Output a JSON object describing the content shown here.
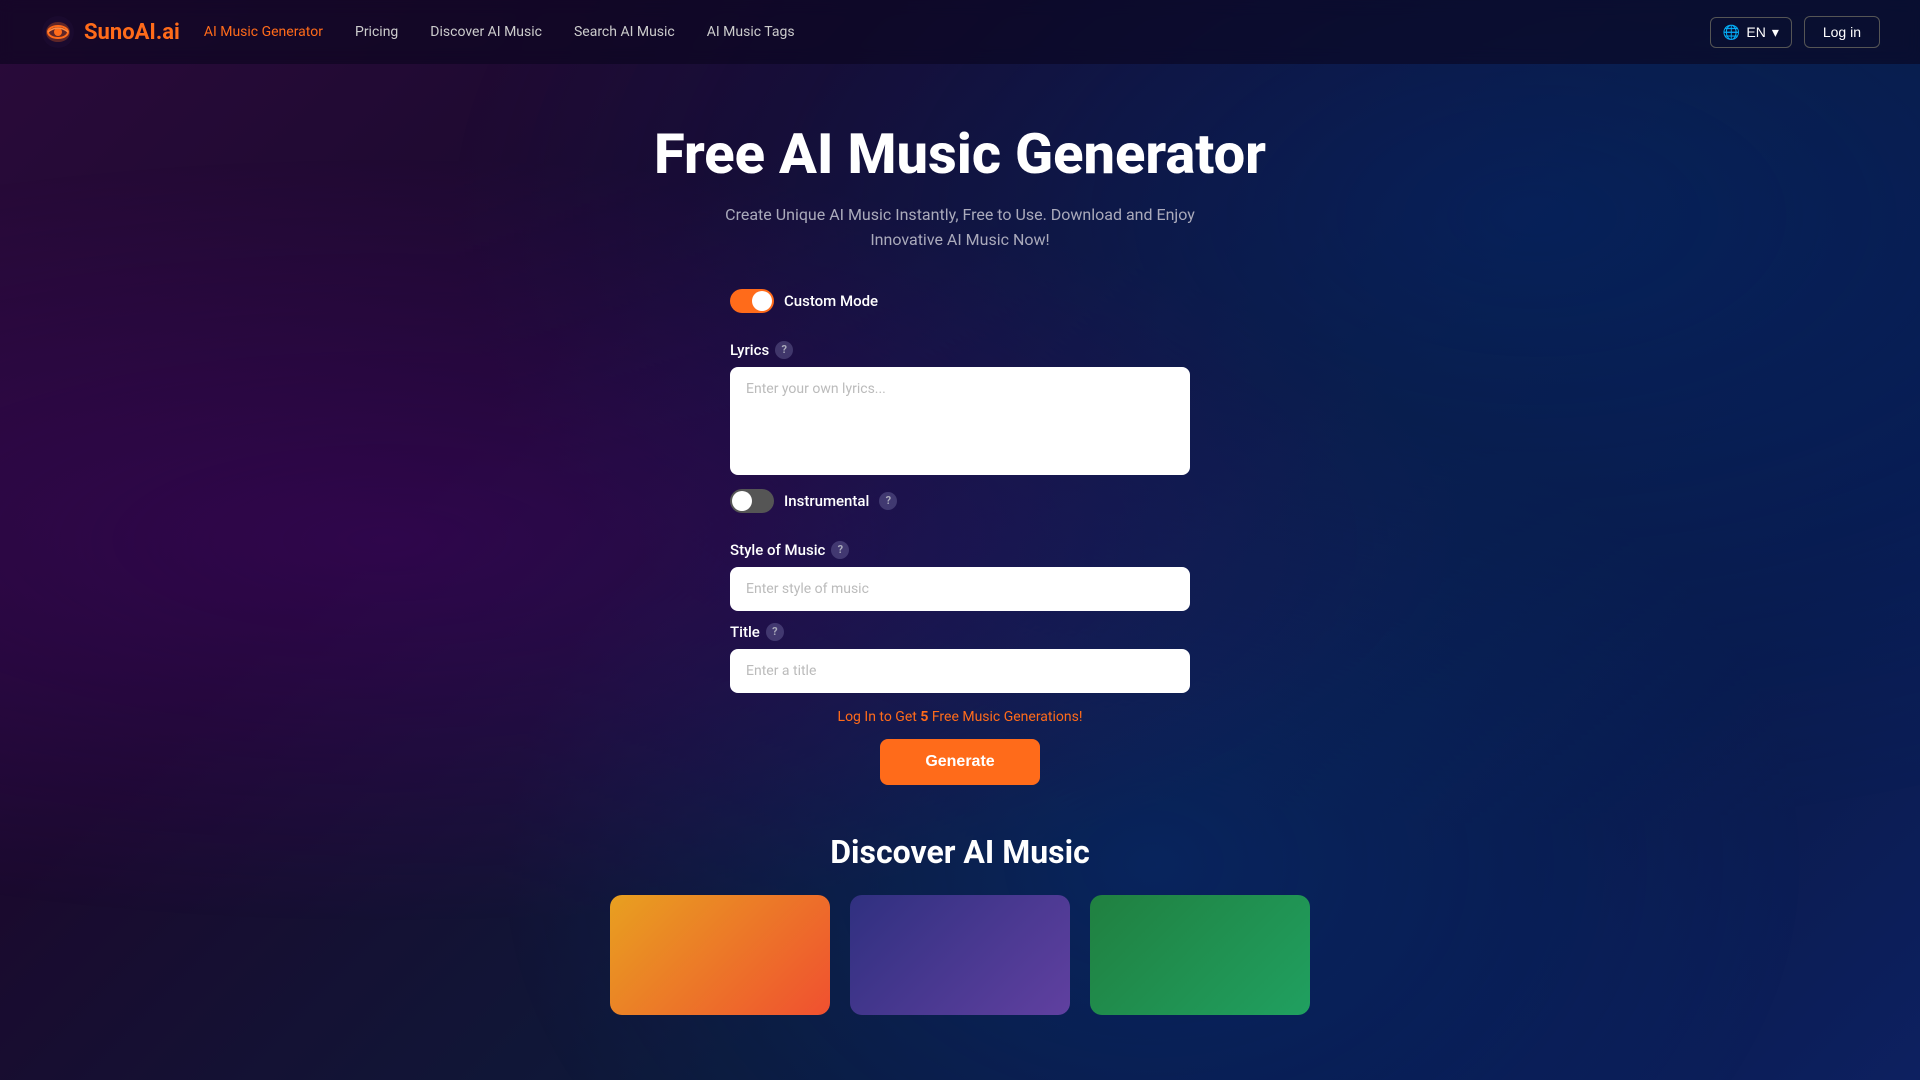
{
  "navbar": {
    "logo_text": "SunoAI.ai",
    "links": [
      {
        "label": "AI Music Generator",
        "active": true,
        "key": "ai-music-generator"
      },
      {
        "label": "Pricing",
        "active": false,
        "key": "pricing"
      },
      {
        "label": "Discover AI Music",
        "active": false,
        "key": "discover-ai-music"
      },
      {
        "label": "Search AI Music",
        "active": false,
        "key": "search-ai-music"
      },
      {
        "label": "AI Music Tags",
        "active": false,
        "key": "ai-music-tags"
      }
    ],
    "lang_button": "EN",
    "login_button": "Log in"
  },
  "hero": {
    "title": "Free AI Music Generator",
    "subtitle": "Create Unique AI Music Instantly, Free to Use. Download and Enjoy Innovative AI Music Now!"
  },
  "form": {
    "custom_mode_label": "Custom Mode",
    "custom_mode_on": true,
    "lyrics_label": "Lyrics",
    "lyrics_placeholder": "Enter your own lyrics...",
    "instrumental_label": "Instrumental",
    "instrumental_on": false,
    "style_label": "Style of Music",
    "style_placeholder": "Enter style of music",
    "title_label": "Title",
    "title_placeholder": "Enter a title",
    "promo_prefix": "Log In to Get ",
    "promo_count": "5",
    "promo_suffix": " Free Music Generations!",
    "generate_button": "Generate"
  },
  "discover": {
    "title": "Discover AI Music"
  },
  "icons": {
    "globe": "🌐",
    "chevron_down": "▾",
    "question": "?"
  }
}
